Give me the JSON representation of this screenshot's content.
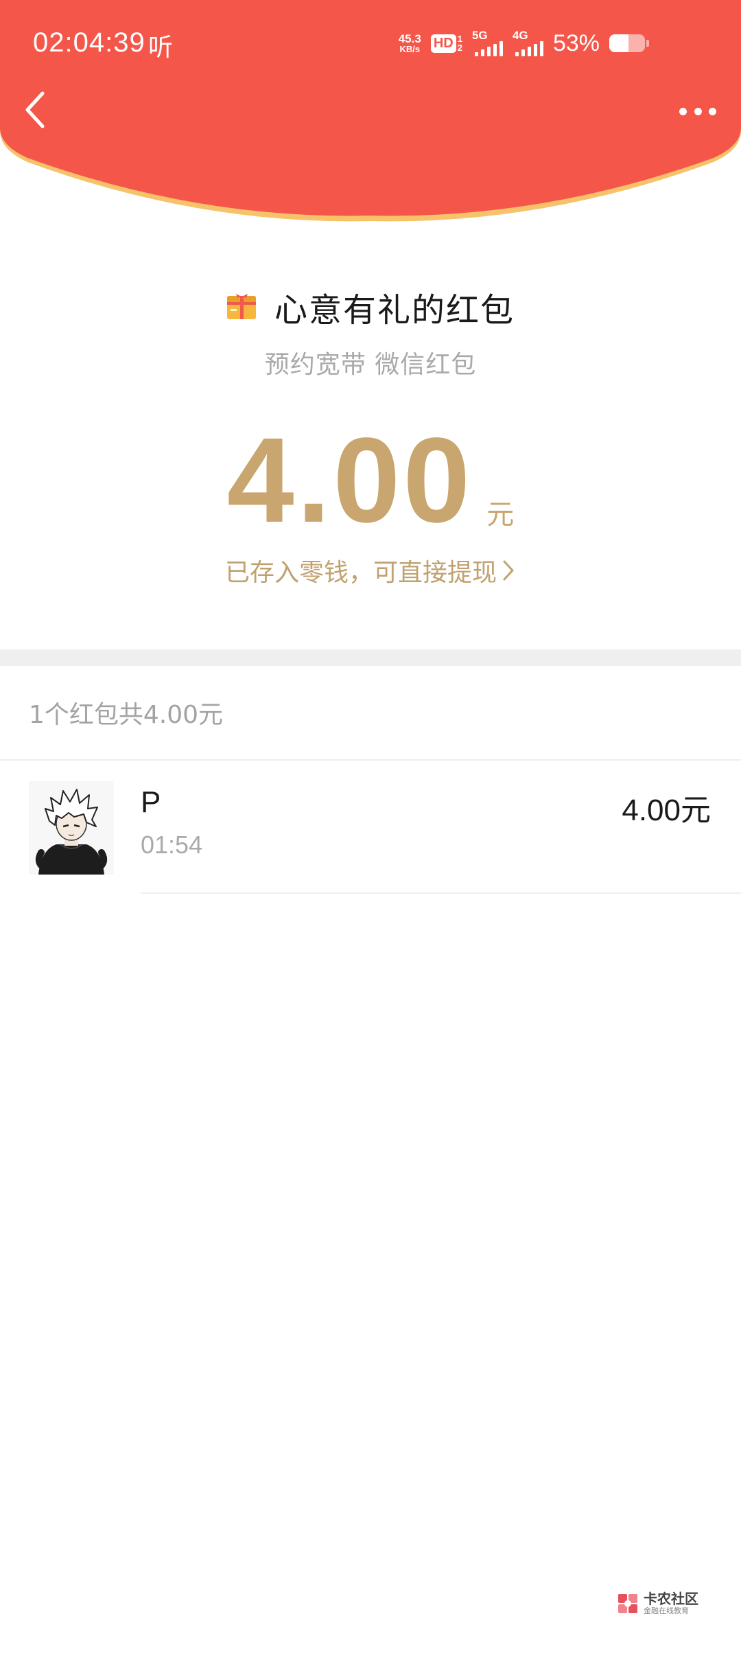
{
  "status_bar": {
    "time": "02:04:39",
    "listen_label": "听",
    "net_speed_value": "45.3",
    "net_speed_unit": "KB/s",
    "hd_label": "HD",
    "hd_sub_top": "1",
    "hd_sub_bottom": "2",
    "signal_5g_label": "5G",
    "signal_4g_label": "4G",
    "battery_percent": "53%",
    "battery_level": 0.53
  },
  "header": {
    "background_color": "#f5564a",
    "curve_edge_color": "#f6c26a",
    "back_icon": "chevron-left-icon",
    "more_icon": "more-dots-icon"
  },
  "red_packet": {
    "icon": "gift-box-icon",
    "title": "心意有礼的红包",
    "subtitle": "预约宽带 微信红包",
    "amount": "4.00",
    "unit": "元",
    "deposit_text": "已存入零钱，可直接提现",
    "accent_color": "#c9a56f"
  },
  "summary": {
    "text": "1个红包共4.00元"
  },
  "records": [
    {
      "name": "P",
      "time": "01:54",
      "amount": "4.00元",
      "avatar": "anime-avatar-icon"
    }
  ],
  "watermark": {
    "main": "卡农社区",
    "sub": "金融在线教育"
  }
}
